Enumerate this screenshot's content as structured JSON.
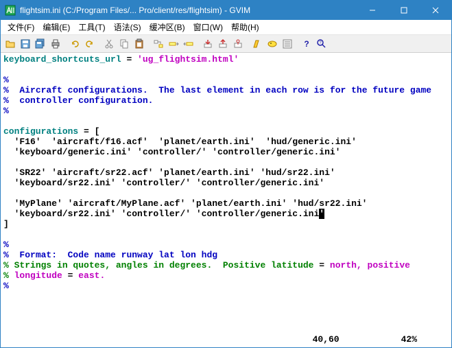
{
  "window": {
    "title": "flightsim.ini (C:/Program Files/... Pro/client/res/flightsim) - GVIM"
  },
  "menus": {
    "file": "文件(F)",
    "edit": "编辑(E)",
    "tools": "工具(T)",
    "syntax": "语法(S)",
    "buffers": "缓冲区(B)",
    "window": "窗口(W)",
    "help": "帮助(H)"
  },
  "editor": {
    "l1_key": "keyboard_shortcuts_url",
    "l1_eq": " = ",
    "l1_val": "'ug_flightsim.html'",
    "pct": "%",
    "c1": "  Aircraft configurations.  The last element in each row is for the future game",
    "c2": "  controller configuration.",
    "cfg": "configurations",
    "cfg_eq": " = [",
    "r1a": "  'F16'  'aircraft/f16.acf'  'planet/earth.ini'  'hud/generic.ini'",
    "r1b": "  'keyboard/generic.ini' 'controller/' 'controller/generic.ini'",
    "r2a": "  'SR22' 'aircraft/sr22.acf' 'planet/earth.ini' 'hud/sr22.ini'",
    "r2b": "  'keyboard/sr22.ini' 'controller/' 'controller/generic.ini'",
    "r3a": "  'MyPlane' 'aircraft/MyPlane.acf' 'planet/earth.ini' 'hud/sr22.ini'",
    "r3b": "  'keyboard/sr22.ini' 'controller/' 'controller/generic.ini",
    "r3c": "'",
    "close": "]",
    "c3": "  Format:  Code name runway lat lon hdg",
    "c4a": " Strings in quotes, angles in degrees.  Positive latitude ",
    "c4eq": "=",
    "c4b": " north, positive",
    "c5a": " longitude ",
    "c5eq": "=",
    "c5b": " east.",
    "blank": ""
  },
  "status": {
    "pos": "40,60",
    "pct": "42%"
  }
}
